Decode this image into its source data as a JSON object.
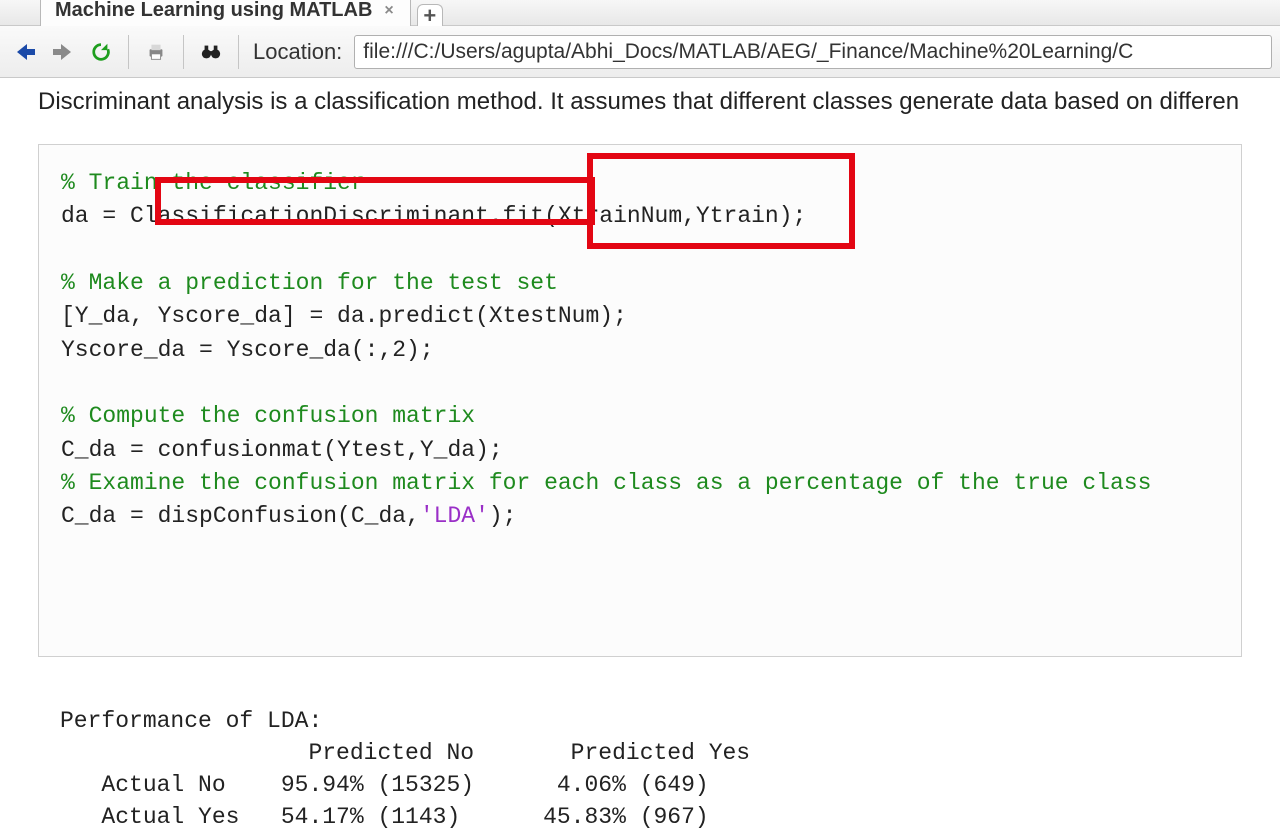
{
  "tab": {
    "title": "Machine Learning using MATLAB"
  },
  "toolbar": {
    "location_label": "Location:",
    "location_value": "file:///C:/Users/agupta/Abhi_Docs/MATLAB/AEG/_Finance/Machine%20Learning/C"
  },
  "intro": "Discriminant analysis is a classification method. It assumes that different classes generate data based on differen",
  "code": {
    "c1": "% Train the classifier",
    "l1a": "da = ",
    "l1b": "ClassificationDiscriminant.fit",
    "l1c": "(XtrainNum,Ytrain)",
    "l1d": ";",
    "c2": "% Make a prediction for the test set",
    "l3": "[Y_da, Yscore_da] = da.predict(XtestNum);",
    "l4": "Yscore_da = Yscore_da(:,2);",
    "c3": "% Compute the confusion matrix",
    "l6": "C_da = confusionmat(Ytest,Y_da);",
    "c4": "% Examine the confusion matrix for each class as a percentage of the true class",
    "l8a": "C_da = dispConfusion(C_da,",
    "l8b": "'LDA'",
    "l8c": ");"
  },
  "output": {
    "title": "Performance of LDA:",
    "hdr": "                  Predicted No       Predicted Yes",
    "r1": "   Actual No    95.94% (15325)      4.06% (649)",
    "r2": "   Actual Yes   54.17% (1143)      45.83% (967)"
  },
  "chart_data": {
    "type": "table",
    "title": "Performance of LDA",
    "columns": [
      "Predicted No",
      "Predicted Yes"
    ],
    "rows": [
      "Actual No",
      "Actual Yes"
    ],
    "percent": [
      [
        95.94,
        4.06
      ],
      [
        54.17,
        45.83
      ]
    ],
    "count": [
      [
        15325,
        649
      ],
      [
        1143,
        967
      ]
    ]
  }
}
